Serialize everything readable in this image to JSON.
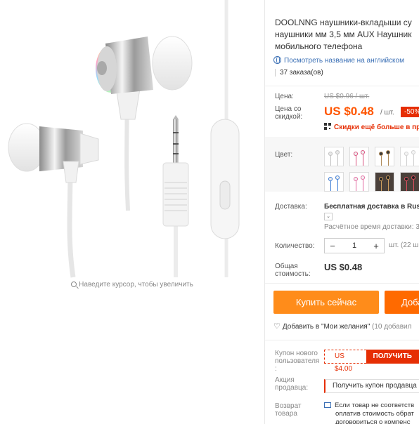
{
  "gallery": {
    "zoom_hint": "Наведите курсор, чтобы увеличить"
  },
  "product": {
    "title_lines": [
      "DOOLNNG наушники-вкладыши су",
      "наушники мм 3,5 мм AUX Наушник",
      "мобильного телефона"
    ],
    "english_link": "Посмотреть название на английском",
    "orders": "37 заказа(ов)"
  },
  "pricing": {
    "price_label": "Цена:",
    "old_price": "US $0.96 / шт.",
    "discount_label_line1": "Цена со",
    "discount_label_line2": "скидкой:",
    "price": "US $0.48",
    "unit": "/ шт.",
    "discount_badge": "-50%",
    "coupon_note": "Скидки ещё больше в пр"
  },
  "variants": {
    "label": "Цвет:",
    "thumbs": [
      {
        "bg": "#ffffff",
        "ep": "#e9e9e9",
        "accent": "#c0c0c0"
      },
      {
        "bg": "#ffffff",
        "ep": "#f0f0f0",
        "accent": "#d94f7d"
      },
      {
        "bg": "#ffffff",
        "ep": "#3b3b3b",
        "accent": "#b08a58"
      },
      {
        "bg": "#ffffff",
        "ep": "#f4f4f4",
        "accent": "#cfcfcf"
      },
      {
        "bg": "#ffffff",
        "ep": "#f4f4f4",
        "accent": "#cfcfcf"
      },
      {
        "bg": "#ffffff",
        "ep": "#eeeeee",
        "accent": "#3a7bd5"
      },
      {
        "bg": "#ffffff",
        "ep": "#f2f2f2",
        "accent": "#e36aa1"
      },
      {
        "bg": "#4a403a",
        "ep": "#1f1f1f",
        "accent": "#d0a060"
      },
      {
        "bg": "#4a403a",
        "ep": "#1f1f1f",
        "accent": "#e05060"
      },
      {
        "bg": "#4a403a",
        "ep": "#1f1f1f",
        "accent": "#c0c0c0"
      }
    ]
  },
  "shipping": {
    "label": "Доставка:",
    "value": "Бесплатная доставка в Rus",
    "time": "Расчётное время доставки: 3"
  },
  "quantity": {
    "label": "Количество:",
    "minus": "−",
    "value": "1",
    "plus": "+",
    "note": "шт. (22 ш"
  },
  "total": {
    "label_line1": "Общая",
    "label_line2": "стоимость:",
    "value": "US $0.48"
  },
  "actions": {
    "buy_now": "Купить сейчас",
    "add_to_cart": "Доба",
    "wishlist": "Добавить в \"Мои желания\"",
    "wishlist_count": "(10 добавил"
  },
  "coupons": {
    "new_user_label_line1": "Купон нового",
    "new_user_label_line2": "пользователя",
    "new_user_label_line3": ":",
    "new_user_amount": "US $4.00",
    "get_button": "ПОЛУЧИТЬ",
    "seller_label_line1": "Акция",
    "seller_label_line2": "продавца:",
    "seller_coupon": "Получить купон продавца"
  },
  "returns": {
    "label_line1": "Возврат",
    "label_line2": "товара",
    "line1": "Если товар не соответств",
    "line2": "оплатив стоимость обрат",
    "line3": "договориться о компенс"
  },
  "colors": {
    "accent_orange": "#ff5500",
    "buy_button": "#ff8c1a",
    "cart_button": "#ff6a00",
    "discount_red": "#e62e04",
    "link_blue": "#3a6fb5"
  }
}
